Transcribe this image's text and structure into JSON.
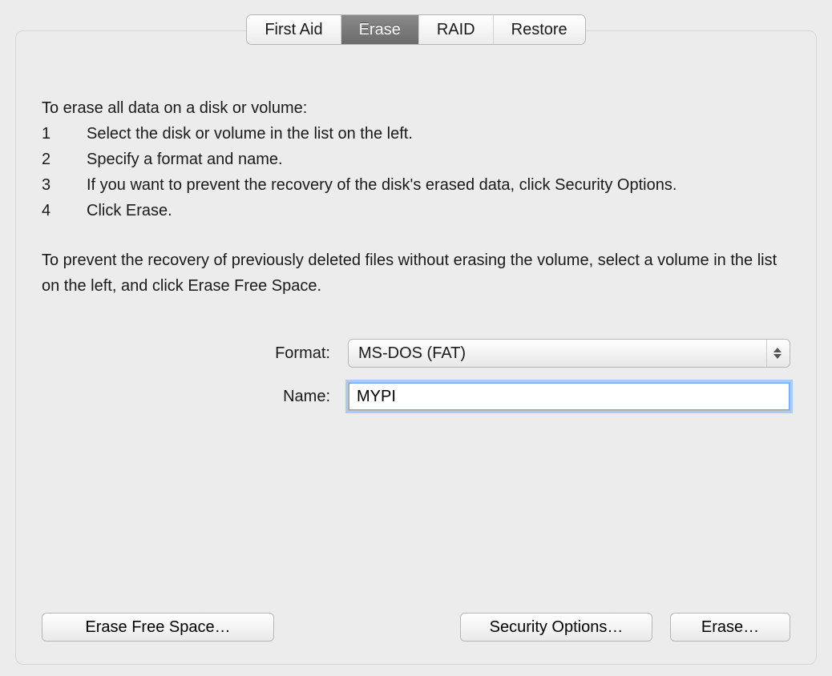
{
  "tabs": {
    "first_aid": "First Aid",
    "erase": "Erase",
    "raid": "RAID",
    "restore": "Restore",
    "active": "erase"
  },
  "instructions": {
    "intro": "To erase all data on a disk or volume:",
    "steps": [
      {
        "num": "1",
        "text": "Select the disk or volume in the list on the left."
      },
      {
        "num": "2",
        "text": "Specify a format and name."
      },
      {
        "num": "3",
        "text": "If you want to prevent the recovery of the disk's erased data, click Security Options."
      },
      {
        "num": "4",
        "text": "Click Erase."
      }
    ],
    "note": "To prevent the recovery of previously deleted files without erasing the volume, select a volume in the list on the left, and click Erase Free Space."
  },
  "form": {
    "format_label": "Format:",
    "format_value": "MS-DOS (FAT)",
    "name_label": "Name:",
    "name_value": "MYPI"
  },
  "buttons": {
    "erase_free_space": "Erase Free Space…",
    "security_options": "Security Options…",
    "erase": "Erase…"
  }
}
